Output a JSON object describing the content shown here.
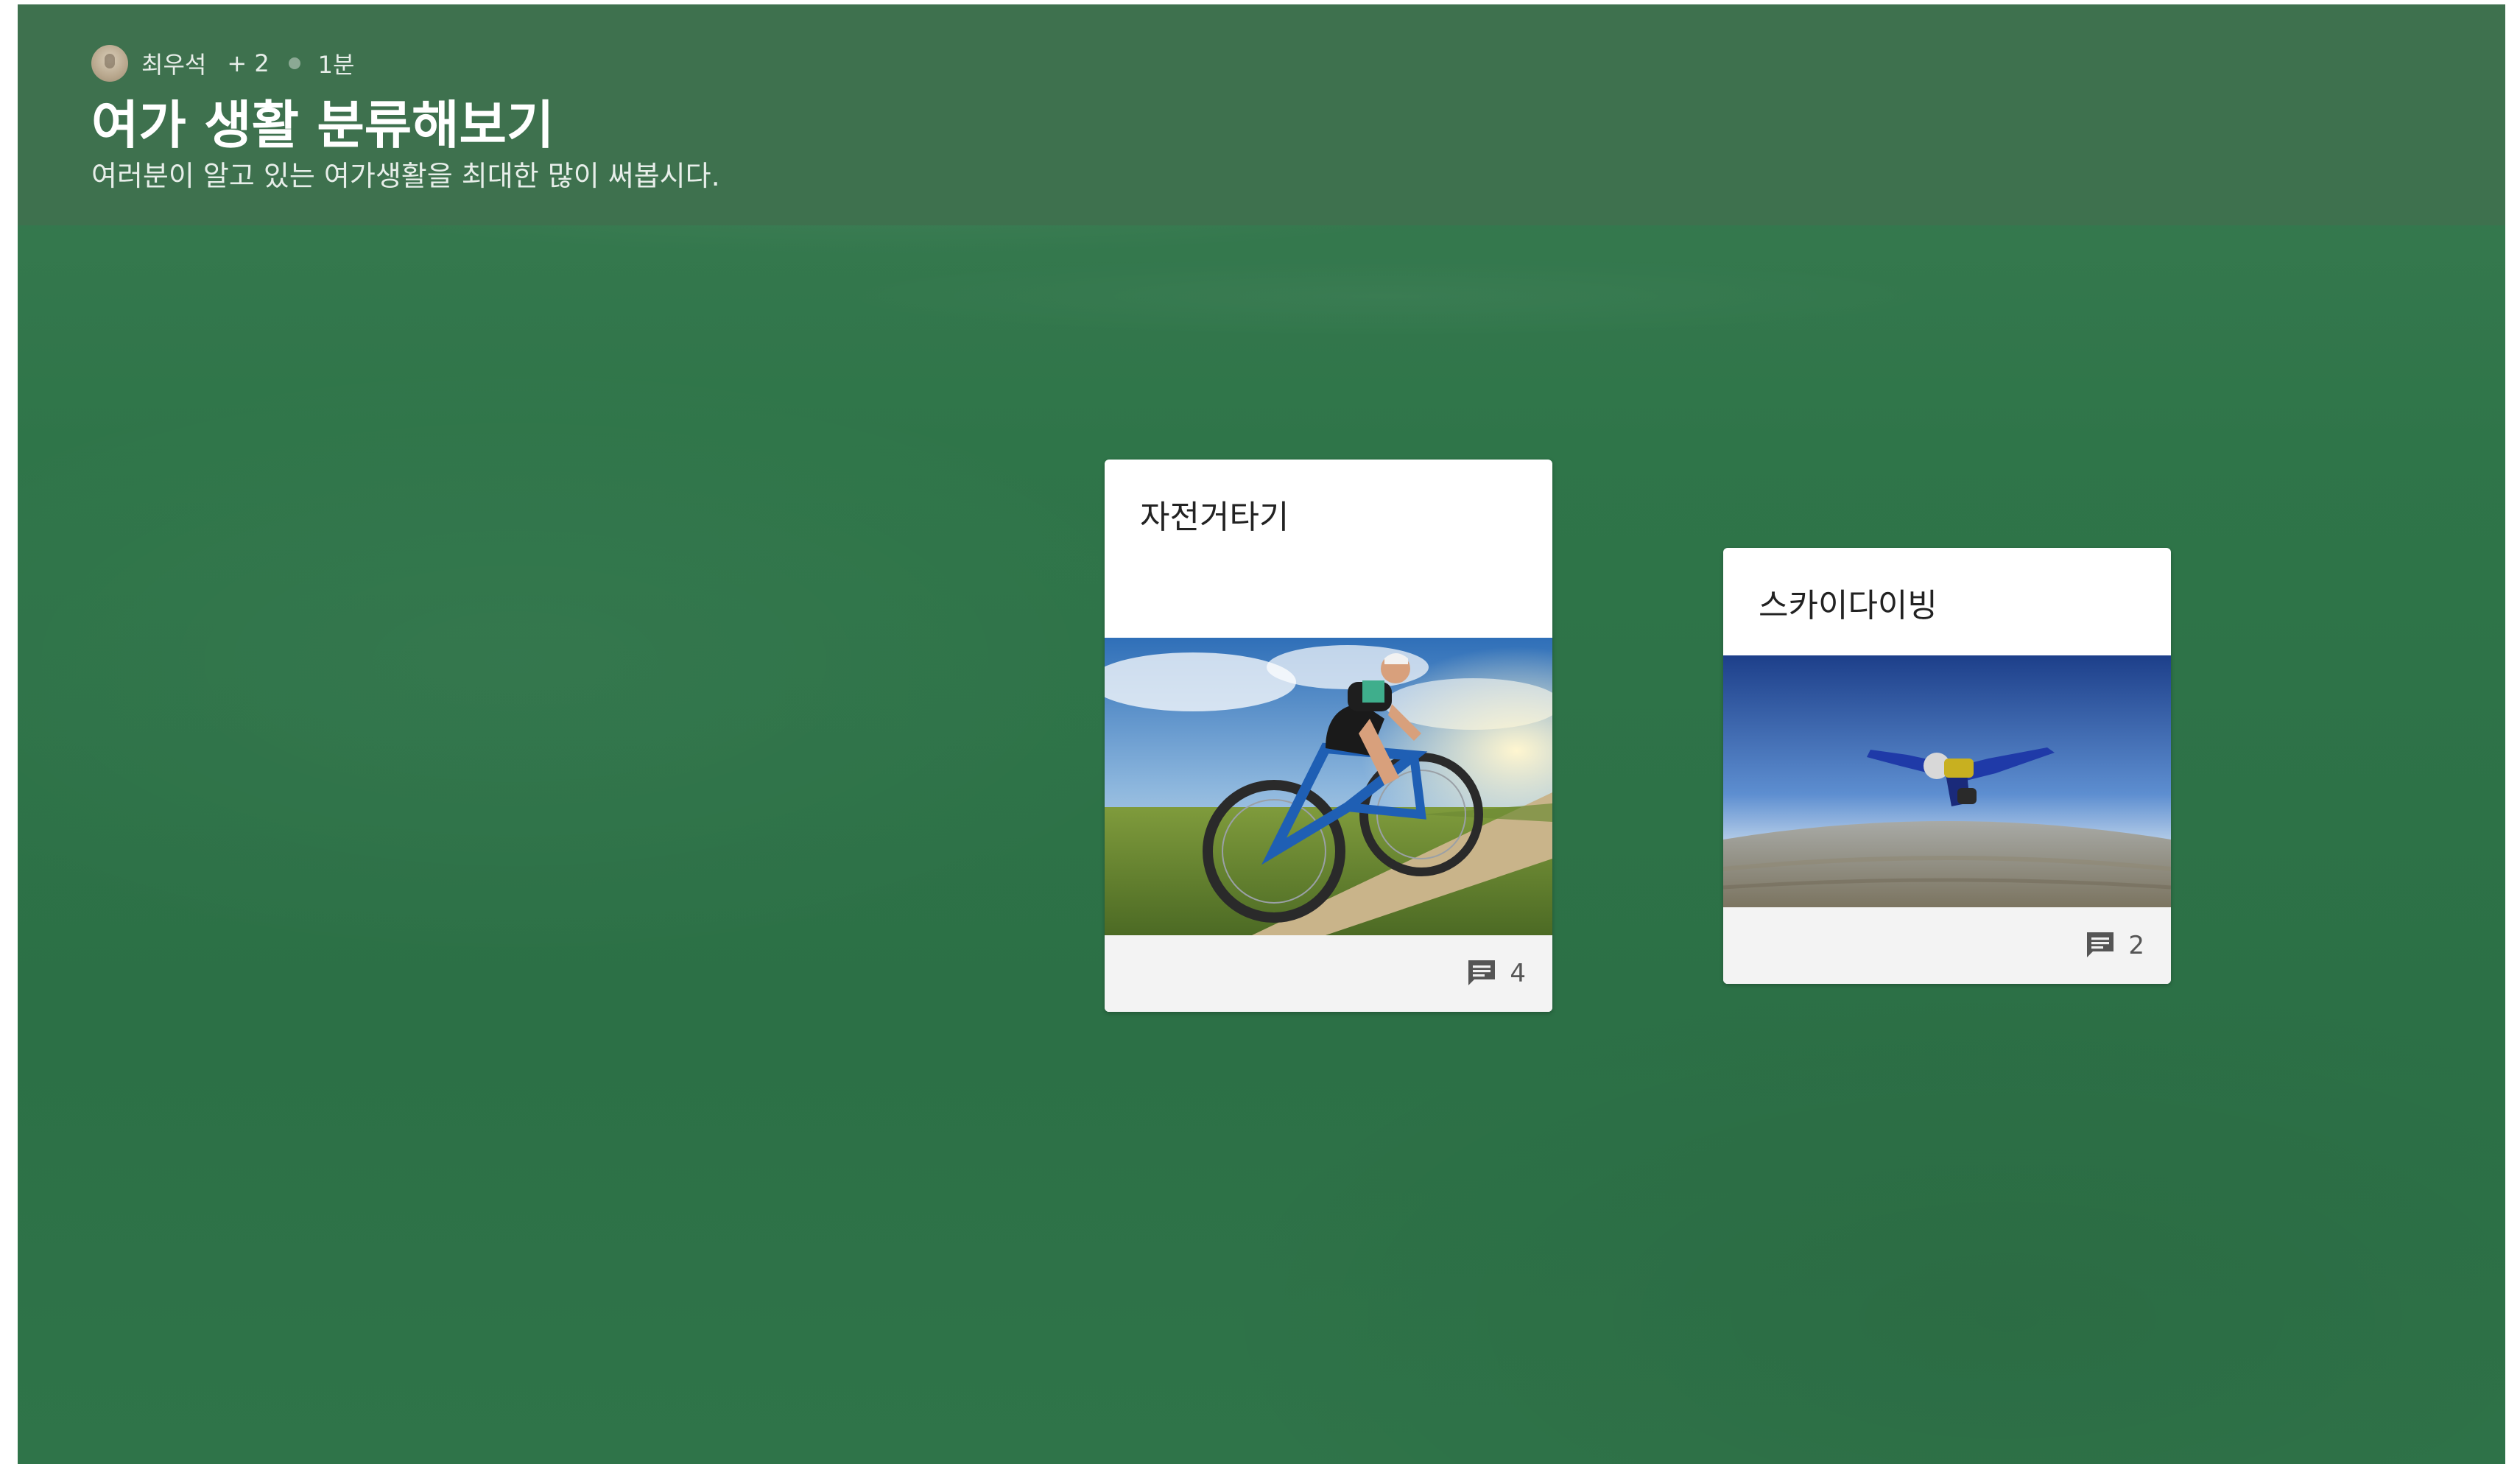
{
  "header": {
    "author": "최우석",
    "plus_count": "+ 2",
    "time_ago": "1분",
    "title": "여가 생활 분류해보기",
    "description": "여러분이 알고 있는 여가생활을 최대한 많이 써봅시다."
  },
  "cards": [
    {
      "title": "자전거타기",
      "image": "cycling-photo",
      "comment_count": "4"
    },
    {
      "title": "스카이다이빙",
      "image": "skydiving-photo",
      "comment_count": "2"
    }
  ],
  "icons": {
    "comment": "comment-icon"
  },
  "colors": {
    "board": "#2f7449",
    "header": "#3e704e",
    "card_footer": "#f3f3f3"
  }
}
